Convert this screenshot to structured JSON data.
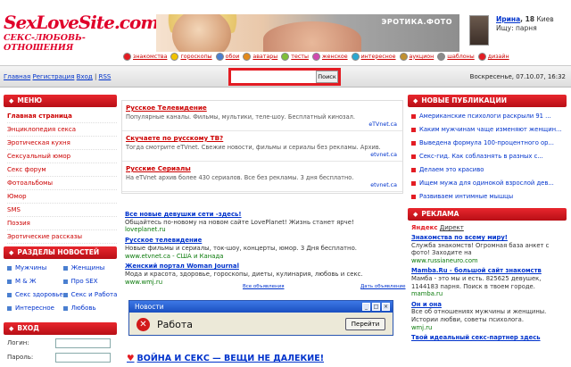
{
  "header": {
    "logo_main": "SexLoveSite.com",
    "logo_sub": "СЕКС-ЛЮБОВЬ-ОТНОШЕНИЯ",
    "banner_label": "ЭРОТИКА.ФОТО",
    "user": {
      "name": "Ирина",
      "age": ", 18",
      "city": "Киев",
      "seeking": "Ищу: парня"
    }
  },
  "categories": [
    {
      "label": "знакомства",
      "color": "#e31c23",
      "icon": "heart-icon"
    },
    {
      "label": "гороскопы",
      "color": "#f2c200",
      "icon": "star-icon"
    },
    {
      "label": "обои",
      "color": "#4a7fd0",
      "icon": "image-icon"
    },
    {
      "label": "аватары",
      "color": "#e38a1c",
      "icon": "avatar-icon"
    },
    {
      "label": "тесты",
      "color": "#7fbf3a",
      "icon": "test-icon"
    },
    {
      "label": "женское",
      "color": "#d04ab0",
      "icon": "female-icon"
    },
    {
      "label": "интересное",
      "color": "#2aa7d0",
      "icon": "globe-icon"
    },
    {
      "label": "аукцион",
      "color": "#c09030",
      "icon": "hammer-icon"
    },
    {
      "label": "шаблоны",
      "color": "#8a8a8a",
      "icon": "template-icon"
    },
    {
      "label": "дизайн",
      "color": "#e31c23",
      "icon": "design-icon"
    }
  ],
  "toplinks": {
    "home": "Главная",
    "register": "Регистрация",
    "login": "Вход",
    "rss": "RSS",
    "sep": "|"
  },
  "search": {
    "placeholder": "",
    "button": "Поиск"
  },
  "datetime": "Воскресенье, 07.10.07, 16:32",
  "menu": {
    "title": "МЕНЮ",
    "items": [
      "Главная страница",
      "Энциклопедия секса",
      "Эротическая кухня",
      "Сексуальный юмор",
      "Секс форум",
      "Фотоальбомы",
      "Юмор",
      "SMS",
      "Поэзия",
      "Эротические рассказы"
    ]
  },
  "sections": {
    "title": "РАЗДЕЛЫ НОВОСТЕЙ",
    "items": [
      "Мужчины",
      "Женщины",
      "М & Ж",
      "Про SEX",
      "Секс здоровье",
      "Секс и Работа",
      "Интересное",
      "Любовь"
    ]
  },
  "login": {
    "title": "ВХОД",
    "login_label": "Логин:",
    "password_label": "Пароль:"
  },
  "tv": [
    {
      "title": "Русское Телевидение",
      "desc": "Популярные каналы. Фильмы, мультики, теле-шоу. Бесплатный кинозал.",
      "src": "eTVnet.ca"
    },
    {
      "title": "Скучаете по русскому ТВ?",
      "desc": "Тогда смотрите eTVnet. Свежие новости, фильмы и сериалы без рекламы. Архив.",
      "src": "etvnet.ca"
    },
    {
      "title": "Русские Сериалы",
      "desc": "На eTVnet архив более 430 сериалов. Все без рекламы. 3 дня бесплатно.",
      "src": "etvnet.ca"
    }
  ],
  "direct": [
    {
      "title": "Все новые девушки сети -здесь!",
      "desc": "Общайтесь по-новому на новом сайте LovePlanet! Жизнь станет ярче!",
      "url": "loveplanet.ru"
    },
    {
      "title": "Русское телевидение",
      "desc": "Новые фильмы и сериалы, ток-шоу, концерты, юмор. 3 Дня бесплатно.",
      "url": "www.etvnet.ca - США и Канада"
    },
    {
      "title": "Женский портал Woman Journal",
      "desc": "Мода и красота, здоровье, гороскопы, диеты, кулинария, любовь и секс.",
      "url": "www.wmj.ru"
    }
  ],
  "direct_links": {
    "all": "Все объявления",
    "place": "Дать объявление"
  },
  "window": {
    "title": "Новости",
    "message": "Работа",
    "button": "Перейти",
    "btn_min": "_",
    "btn_max": "□",
    "btn_close": "×"
  },
  "headline": "ВОЙНА И СЕКС — ВЕЩИ НЕ ДАЛЕКИЕ!",
  "publications": {
    "title": "НОВЫЕ ПУБЛИКАЦИИ",
    "items": [
      "Американские психологи раскрыли 91 ...",
      "Каким мужчинам чаще изменяют женщин...",
      "Выведена формула 100-процентного ор...",
      "Секс-гид. Как соблазнять в разных с...",
      "Делаем это красиво",
      "Ищем мужа для одинокой взрослой дев...",
      "Развиваем интимные мышцы"
    ]
  },
  "ads": {
    "title": "РЕКЛАМА",
    "yandex": "Яндекс",
    "direct": "Директ",
    "items": [
      {
        "title": "Знакомства по всему миру!",
        "desc": "Служба знакомств! Огромная база анкет с фото! Заходите на",
        "url": "www.russianeuro.com"
      },
      {
        "title": "Mamba.Ru - большой сайт знакомств",
        "desc": "Мамба - это мы и есть. 825625 девушек, 1144183 парня. Поиск в твоем городе.",
        "url": "mamba.ru"
      },
      {
        "title": "Он и она",
        "desc": "Все об отношениях мужчины и женщины. Истории любви, советы психолога.",
        "url": "wmj.ru"
      },
      {
        "title": "Твой идеальный секс-партнер здесь",
        "desc": "",
        "url": ""
      }
    ]
  }
}
